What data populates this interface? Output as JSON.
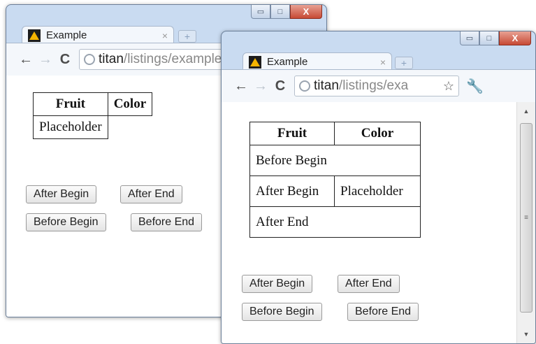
{
  "windows": [
    {
      "tab_title": "Example",
      "tab_close": "×",
      "new_tab": "+",
      "url_host": "titan",
      "url_path": "/listings/example.html",
      "table": {
        "headers": [
          "Fruit",
          "Color"
        ],
        "rows": [
          [
            "Placeholder"
          ]
        ]
      },
      "buttons": [
        "After Begin",
        "After End",
        "Before Begin",
        "Before End"
      ]
    },
    {
      "tab_title": "Example",
      "tab_close": "×",
      "new_tab": "+",
      "url_host": "titan",
      "url_path": "/listings/exa",
      "table": {
        "headers": [
          "Fruit",
          "Color"
        ],
        "rows": [
          [
            "Before Begin"
          ],
          [
            "After Begin",
            "Placeholder"
          ],
          [
            "After End"
          ]
        ]
      },
      "buttons": [
        "After Begin",
        "After End",
        "Before Begin",
        "Before End"
      ]
    }
  ],
  "icons": {
    "back": "←",
    "forward": "→",
    "reload": "C",
    "star": "☆",
    "wrench": "🔧",
    "minimize": "▭",
    "maximize": "□",
    "close": "X",
    "scroll_up": "▲",
    "scroll_down": "▼",
    "grip": "≡"
  },
  "colors": {
    "frame": "#c9dbf1",
    "close_button": "#c74a35",
    "favicon": "#f5b400"
  }
}
